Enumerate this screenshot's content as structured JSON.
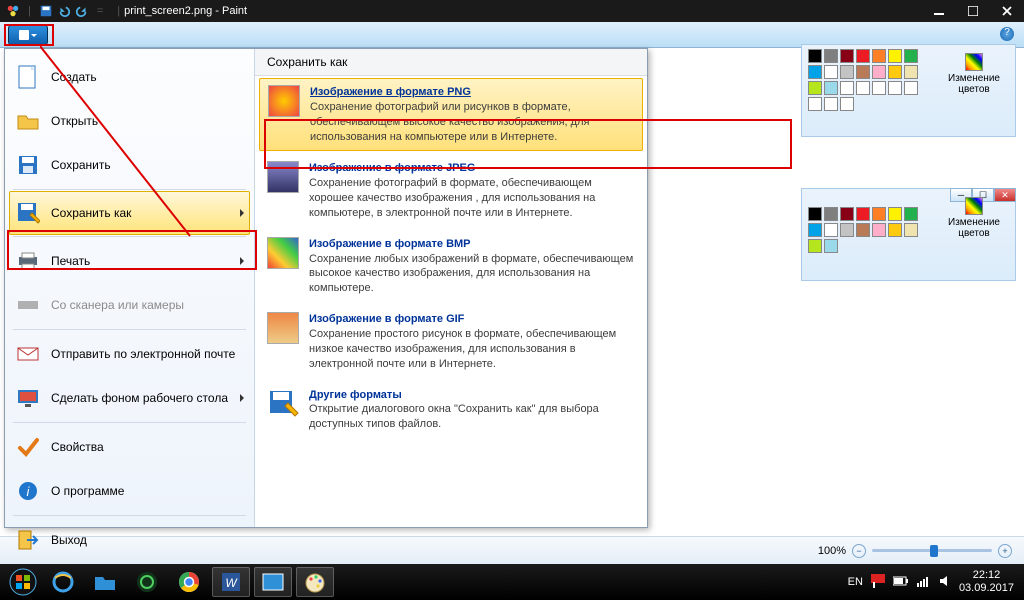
{
  "title_bar": {
    "filename": "print_screen2.png",
    "app": "Paint"
  },
  "menu": {
    "create": "Создать",
    "open": "Открыть",
    "save": "Сохранить",
    "saveas": "Сохранить как",
    "print": "Печать",
    "scanner": "Со сканера или камеры",
    "email": "Отправить по электронной почте",
    "wallpaper": "Сделать фоном рабочего стола",
    "props": "Свойства",
    "about": "О программе",
    "exit": "Выход"
  },
  "saveas_panel": {
    "header": "Сохранить как",
    "png_title": "Изображение в формате PNG",
    "png_desc": "Сохранение фотографий или рисунков в формате, обеспечивающем высокое качество изображения, для использования на компьютере или в Интернете.",
    "jpeg_title": "Изображение в формате JPEG",
    "jpeg_desc": "Сохранение фотографий в формате, обеспечивающем хорошее качество изображения , для использования на компьютере, в электронной почте или в Интернете.",
    "bmp_title": "Изображение в формате BMP",
    "bmp_desc": "Сохранение любых изображений в формате, обеспечивающем высокое качество изображения, для использования на компьютере.",
    "gif_title": "Изображение в формате GIF",
    "gif_desc": "Сохранение простого рисунок в формате, обеспечивающем низкое качество изображения, для использования в электронной почте или в Интернете.",
    "other_title": "Другие форматы",
    "other_desc": "Открытие диалогового окна \"Сохранить как\" для выбора доступных типов файлов."
  },
  "colors_label": "Изменение цветов",
  "zoom_label": "100%",
  "tray": {
    "lang": "EN",
    "time": "22:12",
    "date": "03.09.2017"
  }
}
